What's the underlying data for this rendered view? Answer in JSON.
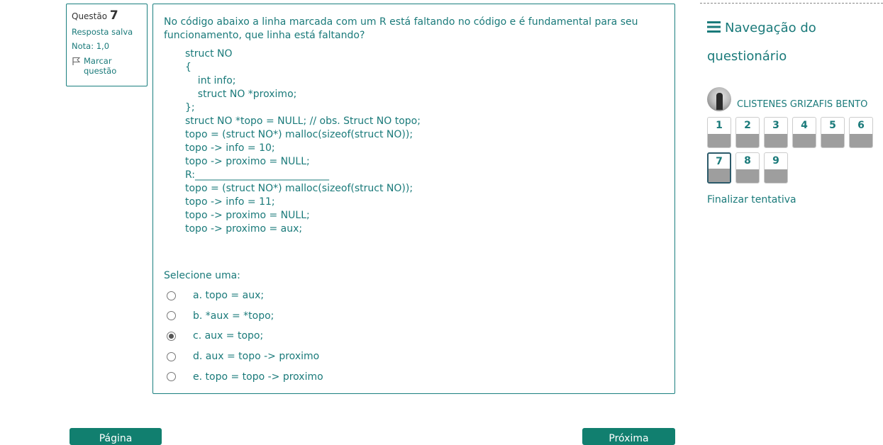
{
  "question_info": {
    "label": "Questão",
    "number": "7",
    "status": "Resposta salva",
    "grade": "Nota: 1,0",
    "flag_label": "Marcar questão"
  },
  "question": {
    "prompt": "No código abaixo a linha marcada com um R está faltando no código e é fundamental para seu funcionamento, que linha está faltando?",
    "code": "struct NO\n{\n    int info;\n    struct NO *proximo;\n};\nstruct NO *topo = NULL; // obs. Struct NO topo;\ntopo = (struct NO*) malloc(sizeof(struct NO));\ntopo -> info = 10;\ntopo -> proximo = NULL;\nR:___________________________\ntopo = (struct NO*) malloc(sizeof(struct NO));\ntopo -> info = 11;\ntopo -> proximo = NULL;\ntopo -> proximo = aux;",
    "select_label": "Selecione uma:",
    "options": [
      {
        "label": "a. topo = aux;",
        "checked": false
      },
      {
        "label": "b. *aux = *topo;",
        "checked": false
      },
      {
        "label": "c. aux = topo;",
        "checked": true
      },
      {
        "label": "d. aux = topo -> proximo",
        "checked": false
      },
      {
        "label": "e. topo = topo -> proximo",
        "checked": false
      }
    ]
  },
  "buttons": {
    "prev": "Página anterior",
    "next": "Próxima página"
  },
  "navigation": {
    "title": "Navegação do questionário",
    "user": "CLISTENES GRIZAFIS BENTO",
    "questions": [
      "1",
      "2",
      "3",
      "4",
      "5",
      "6",
      "7",
      "8",
      "9"
    ],
    "current": "7",
    "finish": "Finalizar tentativa"
  },
  "colors": {
    "accent": "#1a7a7a",
    "button": "#117f6f",
    "answered_fill": "#9e9e9e",
    "current_border": "#2c5a6a"
  },
  "icons": {
    "flag": "flag-icon",
    "menu": "hamburger-icon",
    "radio": "radio-icon"
  }
}
